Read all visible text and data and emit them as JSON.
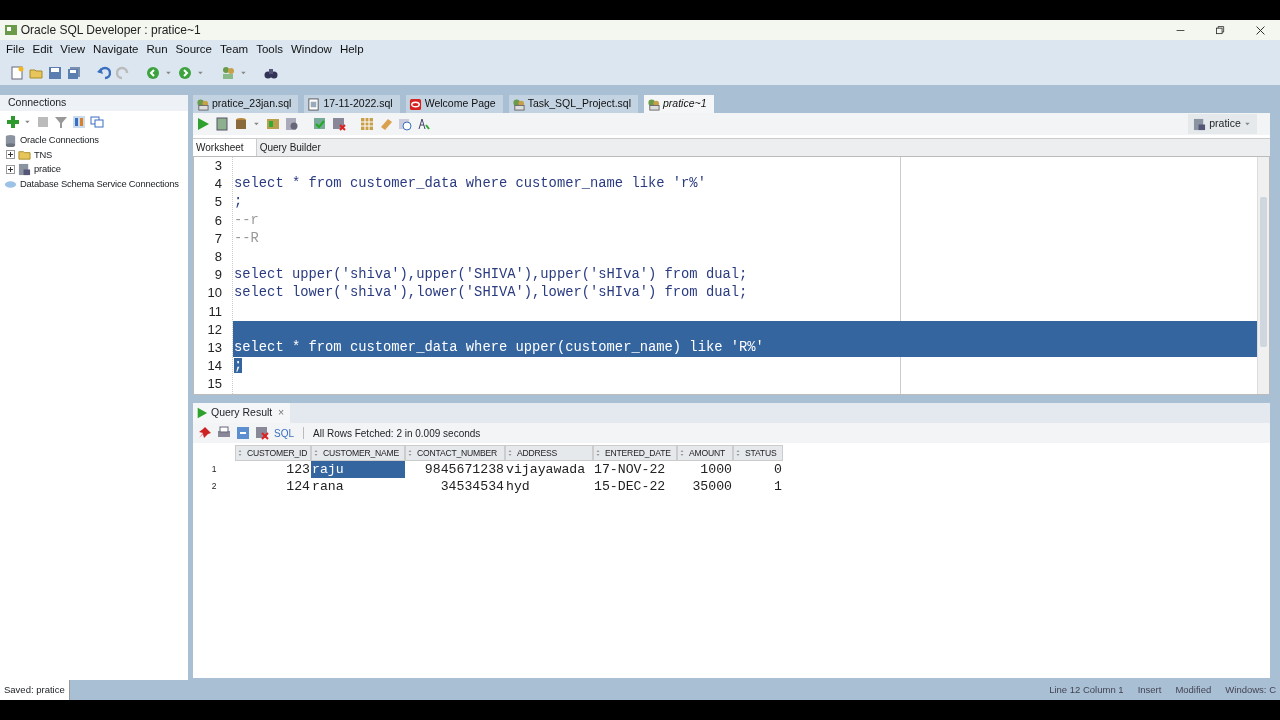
{
  "window": {
    "title": "Oracle SQL Developer : pratice~1"
  },
  "menu": [
    "File",
    "Edit",
    "View",
    "Navigate",
    "Run",
    "Source",
    "Team",
    "Tools",
    "Window",
    "Help"
  ],
  "connections": {
    "title": "Connections",
    "tree": [
      {
        "label": "Oracle Connections",
        "children": [
          {
            "label": "TNS",
            "expanded": false,
            "kind": "folder"
          },
          {
            "label": "pratice",
            "expanded": false,
            "kind": "connection"
          }
        ],
        "kind": "root"
      },
      {
        "label": "Database Schema Service Connections",
        "kind": "cloud"
      }
    ]
  },
  "editor_tabs": [
    {
      "label": "pratice_23jan.sql",
      "kind": "sql",
      "selected": false
    },
    {
      "label": "17-11-2022.sql",
      "kind": "file",
      "selected": false
    },
    {
      "label": "Welcome Page",
      "kind": "web",
      "selected": false
    },
    {
      "label": "Task_SQL_Project.sql",
      "kind": "sql",
      "selected": false
    },
    {
      "label": "pratice~1",
      "kind": "sql",
      "selected": true
    }
  ],
  "connection_selector": "pratice",
  "sub_tabs": [
    {
      "label": "Worksheet",
      "selected": true
    },
    {
      "label": "Query Builder",
      "selected": false
    }
  ],
  "code_lines": [
    {
      "number": "3",
      "kind": "code",
      "selected": false
    },
    {
      "number": "4",
      "text": "select * from customer_data where customer_name like 'r%'",
      "kind": "code",
      "selected": false
    },
    {
      "number": "5",
      "text": ";",
      "kind": "code",
      "selected": false
    },
    {
      "number": "6",
      "text": "--r",
      "kind": "comment",
      "selected": false
    },
    {
      "number": "7",
      "text": "--R",
      "kind": "comment",
      "selected": false
    },
    {
      "number": "8",
      "kind": "code",
      "selected": false
    },
    {
      "number": "9",
      "text": "select upper('shiva'),upper('SHIVA'),upper('sHIva') from dual;",
      "kind": "code",
      "selected": false
    },
    {
      "number": "10",
      "text": "select lower('shiva'),lower('SHIVA'),lower('sHIva') from dual;",
      "kind": "code",
      "selected": false
    },
    {
      "number": "11",
      "kind": "code",
      "selected": false
    },
    {
      "number": "12",
      "kind": "code",
      "selected": true,
      "full_width": true
    },
    {
      "number": "13",
      "text": "select * from customer_data where upper(customer_name) like 'R%'",
      "kind": "code",
      "selected": true,
      "full_width": true
    },
    {
      "number": "14",
      "text": ";",
      "kind": "code",
      "selected": true,
      "full_width": false
    },
    {
      "number": "15",
      "kind": "code",
      "selected": false
    }
  ],
  "result": {
    "tab": "Query Result",
    "close": "×",
    "sql_label": "SQL",
    "message": "All Rows Fetched: 2 in 0.009 seconds",
    "columns": [
      {
        "label": "CUSTOMER_ID",
        "kind": "number"
      },
      {
        "label": "CUSTOMER_NAME",
        "kind": "text"
      },
      {
        "label": "CONTACT_NUMBER",
        "kind": "number"
      },
      {
        "label": "ADDRESS",
        "kind": "text"
      },
      {
        "label": "ENTERED_DATE",
        "kind": "text"
      },
      {
        "label": "AMOUNT",
        "kind": "number"
      },
      {
        "label": "STATUS",
        "kind": "number"
      }
    ],
    "rows": [
      {
        "number": "1",
        "cells": [
          {
            "text": "123",
            "selected": false
          },
          {
            "text": "raju",
            "selected": true
          },
          {
            "text": "9845671238",
            "selected": false
          },
          {
            "text": "vijayawada",
            "selected": false
          },
          {
            "text": "17-NOV-22",
            "selected": false
          },
          {
            "text": "1000",
            "selected": false
          },
          {
            "text": "0",
            "selected": false
          }
        ]
      },
      {
        "number": "2",
        "cells": [
          {
            "text": "124",
            "selected": false
          },
          {
            "text": "rana",
            "selected": false
          },
          {
            "text": "34534534",
            "selected": false
          },
          {
            "text": "hyd",
            "selected": false
          },
          {
            "text": "15-DEC-22",
            "selected": false
          },
          {
            "text": "35000",
            "selected": false
          },
          {
            "text": "1",
            "selected": false
          }
        ]
      }
    ]
  },
  "status_bar": {
    "left": "Saved: pratice",
    "items": [
      "Line 12 Column 1",
      "Insert",
      "Modified",
      "Windows: C"
    ]
  }
}
